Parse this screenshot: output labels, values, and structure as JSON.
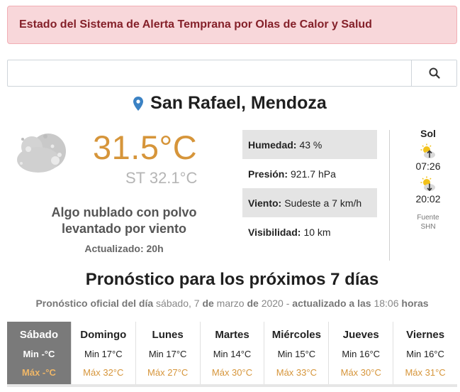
{
  "alert": {
    "text": "Estado del Sistema de Alerta Temprana por Olas de Calor y Salud"
  },
  "search": {
    "value": "",
    "placeholder": "",
    "icon": "search-icon"
  },
  "location": {
    "icon": "map-pin-icon",
    "name": "San Rafael, Mendoza",
    "pin_color": "#3b82c4"
  },
  "current": {
    "icon": "cloud-dust-icon",
    "temperature": "31.5°C",
    "feels_like": "ST 32.1°C",
    "description_line1": "Algo nublado con polvo",
    "description_line2": "levantado por viento",
    "updated": "Actualizado: 20h"
  },
  "stats": [
    {
      "label": "Humedad:",
      "value": "43 %"
    },
    {
      "label": "Presión:",
      "value": "921.7 hPa"
    },
    {
      "label": "Viento:",
      "value": "Sudeste a 7 km/h"
    },
    {
      "label": "Visibilidad:",
      "value": "10 km"
    }
  ],
  "sun": {
    "title": "Sol",
    "sunrise_icon": "sunrise-icon",
    "sunrise": "07:26",
    "sunset_icon": "sunset-icon",
    "sunset": "20:02",
    "source_line1": "Fuente",
    "source_line2": "SHN"
  },
  "forecast": {
    "title": "Pronóstico para los próximos 7 días",
    "subtitle": {
      "p1": "Pronóstico oficial del día",
      "p2": "sábado, 7",
      "p3": "de",
      "p4": "marzo",
      "p5": "de",
      "p6": "2020 -",
      "p7": "actualizado a las",
      "p8": "18:06",
      "p9": "horas"
    },
    "days": [
      {
        "name": "Sábado",
        "min": "Min -°C",
        "max": "Máx -°C"
      },
      {
        "name": "Domingo",
        "min": "Min 17°C",
        "max": "Máx 32°C"
      },
      {
        "name": "Lunes",
        "min": "Min 17°C",
        "max": "Máx 27°C"
      },
      {
        "name": "Martes",
        "min": "Min 14°C",
        "max": "Máx 30°C"
      },
      {
        "name": "Miércoles",
        "min": "Min 15°C",
        "max": "Máx 33°C"
      },
      {
        "name": "Jueves",
        "min": "Min 16°C",
        "max": "Máx 30°C"
      },
      {
        "name": "Viernes",
        "min": "Min 16°C",
        "max": "Máx 31°C"
      }
    ]
  },
  "colors": {
    "alert_bg": "#f8d7da",
    "alert_text": "#842029",
    "accent": "#d6953a",
    "active_tab": "#7a7a7a"
  }
}
